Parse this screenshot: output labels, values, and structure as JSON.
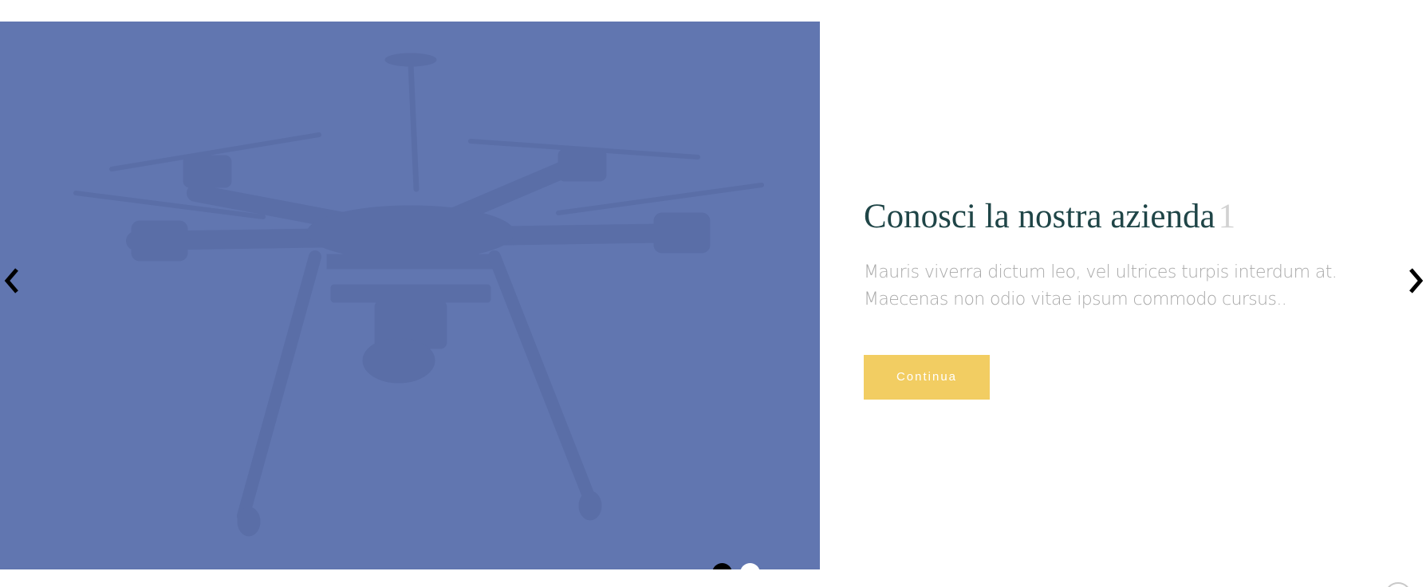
{
  "slide": {
    "title": "Conosci la nostra azienda",
    "number": "1",
    "description_line1": "Mauris viverra dictum leo, vel ultrices turpis interdum at.",
    "description_line2": "Maecenas non odio vitae ipsum commodo cursus..",
    "button_label": "Continua",
    "image_subject": "drone-image"
  },
  "navigation": {
    "prev_icon": "chevron-left-icon",
    "next_icon": "chevron-right-icon",
    "dots": [
      {
        "state": "active"
      },
      {
        "state": "inactive"
      }
    ]
  },
  "colors": {
    "image_overlay": "#6176b0",
    "title": "#1f4547",
    "number": "#d2d2d2",
    "description": "#a9a9a9",
    "button": "#f2cd62",
    "button_text": "#ffffff"
  }
}
